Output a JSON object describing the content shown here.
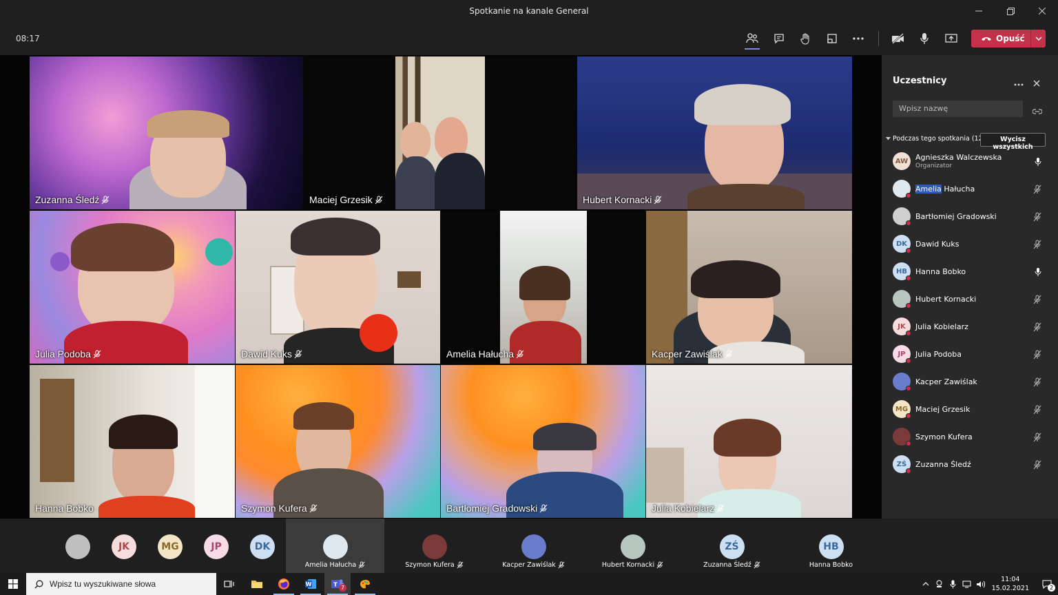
{
  "window": {
    "title": "Spotkanie na kanale General"
  },
  "toolbar": {
    "timer": "08:17",
    "leave_label": "Opuść"
  },
  "tiles": [
    {
      "name": "Zuzanna Śledź"
    },
    {
      "name": "Maciej Grzesik"
    },
    {
      "name": "Hubert Kornacki"
    },
    {
      "name": "Julia Podoba"
    },
    {
      "name": "Dawid Kuks"
    },
    {
      "name": "Amelia Hałucha"
    },
    {
      "name": "Kacper Zawiślak"
    },
    {
      "name": "Hanna Bobko"
    },
    {
      "name": "Szymon Kufera"
    },
    {
      "name": "Bartłomiej Gradowski"
    },
    {
      "name": "Julia Kobielarz"
    }
  ],
  "panel": {
    "title": "Uczestnicy",
    "search_placeholder": "Wpisz nazwę",
    "section_label": "Podczas tego spotkania (12)",
    "mute_all_label": "Wycisz wszystkich",
    "participants": [
      {
        "name_highlight": "",
        "name": "Agnieszka Walczewska",
        "role": "Organizator",
        "initials": "AW",
        "color": "#f1e0d6",
        "text_color": "#8a5a44",
        "mic": "on"
      },
      {
        "name_highlight": "Amelia",
        "name": " Hałucha",
        "role": "",
        "initials": "",
        "color": "#dfe7ef",
        "text_color": "#333",
        "mic": "off"
      },
      {
        "name_highlight": "",
        "name": "Bartłomiej Gradowski",
        "role": "",
        "initials": "",
        "color": "#cfcfcf",
        "text_color": "#333",
        "mic": "off"
      },
      {
        "name_highlight": "",
        "name": "Dawid Kuks",
        "role": "",
        "initials": "DK",
        "color": "#cde0f3",
        "text_color": "#3b6a9c",
        "mic": "off"
      },
      {
        "name_highlight": "",
        "name": "Hanna Bobko",
        "role": "",
        "initials": "HB",
        "color": "#cde0f3",
        "text_color": "#3b6a9c",
        "mic": "on"
      },
      {
        "name_highlight": "",
        "name": "Hubert Kornacki",
        "role": "",
        "initials": "",
        "color": "#b8c6c0",
        "text_color": "#333",
        "mic": "off"
      },
      {
        "name_highlight": "",
        "name": "Julia Kobielarz",
        "role": "",
        "initials": "JK",
        "color": "#f6dcdc",
        "text_color": "#b04a4a",
        "mic": "off"
      },
      {
        "name_highlight": "",
        "name": "Julia Podoba",
        "role": "",
        "initials": "JP",
        "color": "#f7dbe6",
        "text_color": "#a8456d",
        "mic": "off"
      },
      {
        "name_highlight": "",
        "name": "Kacper Zawiślak",
        "role": "",
        "initials": "",
        "color": "#6a7ccc",
        "text_color": "#fff",
        "mic": "off"
      },
      {
        "name_highlight": "",
        "name": "Maciej Grzesik",
        "role": "",
        "initials": "MG",
        "color": "#f3e5c5",
        "text_color": "#8a6a2a",
        "mic": "off"
      },
      {
        "name_highlight": "",
        "name": "Szymon Kufera",
        "role": "",
        "initials": "",
        "color": "#7a3a3a",
        "text_color": "#fff",
        "mic": "off"
      },
      {
        "name_highlight": "",
        "name": "Zuzanna Śledź",
        "role": "",
        "initials": "ZŚ",
        "color": "#cde0f3",
        "text_color": "#3b6a9c",
        "mic": "off"
      }
    ]
  },
  "strip": {
    "small": [
      {
        "initials": "",
        "color": "#bfbfbf",
        "text_color": "#333"
      },
      {
        "initials": "JK",
        "color": "#f6dcdc",
        "text_color": "#b04a4a"
      },
      {
        "initials": "MG",
        "color": "#f3e5c5",
        "text_color": "#8a6a2a"
      },
      {
        "initials": "JP",
        "color": "#f7dbe6",
        "text_color": "#a8456d"
      },
      {
        "initials": "DK",
        "color": "#cde0f3",
        "text_color": "#3b6a9c"
      }
    ],
    "cells": [
      {
        "name": "Amelia Hałucha",
        "initials": "",
        "color": "#dfe7ef",
        "text_color": "#333",
        "muted": true
      },
      {
        "name": "Szymon Kufera",
        "initials": "",
        "color": "#7a3a3a",
        "text_color": "#fff",
        "muted": true
      },
      {
        "name": "Kacper Zawiślak",
        "initials": "",
        "color": "#6a7ccc",
        "text_color": "#fff",
        "muted": true
      },
      {
        "name": "Hubert Kornacki",
        "initials": "",
        "color": "#b8c6c0",
        "text_color": "#333",
        "muted": true
      },
      {
        "name": "Zuzanna Śledź",
        "initials": "ZŚ",
        "color": "#cde0f3",
        "text_color": "#3b6a9c",
        "muted": true
      },
      {
        "name": "Hanna Bobko",
        "initials": "HB",
        "color": "#cde0f3",
        "text_color": "#3b6a9c",
        "muted": false
      }
    ]
  },
  "taskbar": {
    "search_placeholder": "Wpisz tu wyszukiwane słowa",
    "time": "11:04",
    "date": "15.02.2021",
    "teams_badge": "7",
    "notif_badge": "2"
  }
}
